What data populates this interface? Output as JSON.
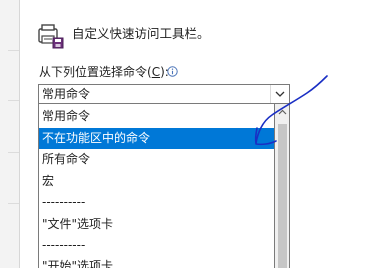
{
  "header": {
    "title": "自定义快速访问工具栏。",
    "icon": "quick-access-toolbar-icon"
  },
  "choose_commands": {
    "label_before": "从下列位置选择命令(",
    "access_key": "C",
    "label_after": "):",
    "info_icon": "info-icon",
    "selected_value": "常用命令",
    "dropdown_icon": "chevron-down-icon"
  },
  "dropdown": {
    "items": [
      {
        "label": "常用命令",
        "selected": false
      },
      {
        "label": "不在功能区中的命令",
        "selected": true
      },
      {
        "label": "所有命令",
        "selected": false
      },
      {
        "label": "宏",
        "selected": false
      },
      {
        "label": "----------",
        "selected": false
      },
      {
        "label": "\"文件\"选项卡",
        "selected": false
      },
      {
        "label": "----------",
        "selected": false
      },
      {
        "label": "\"开始\"选项卡",
        "selected": false
      }
    ]
  },
  "colors": {
    "selection": "#0078d7",
    "annotation_ink": "#1a2fc4",
    "panel_background": "#ffffff",
    "sidebar_background": "#f3f3f3"
  }
}
